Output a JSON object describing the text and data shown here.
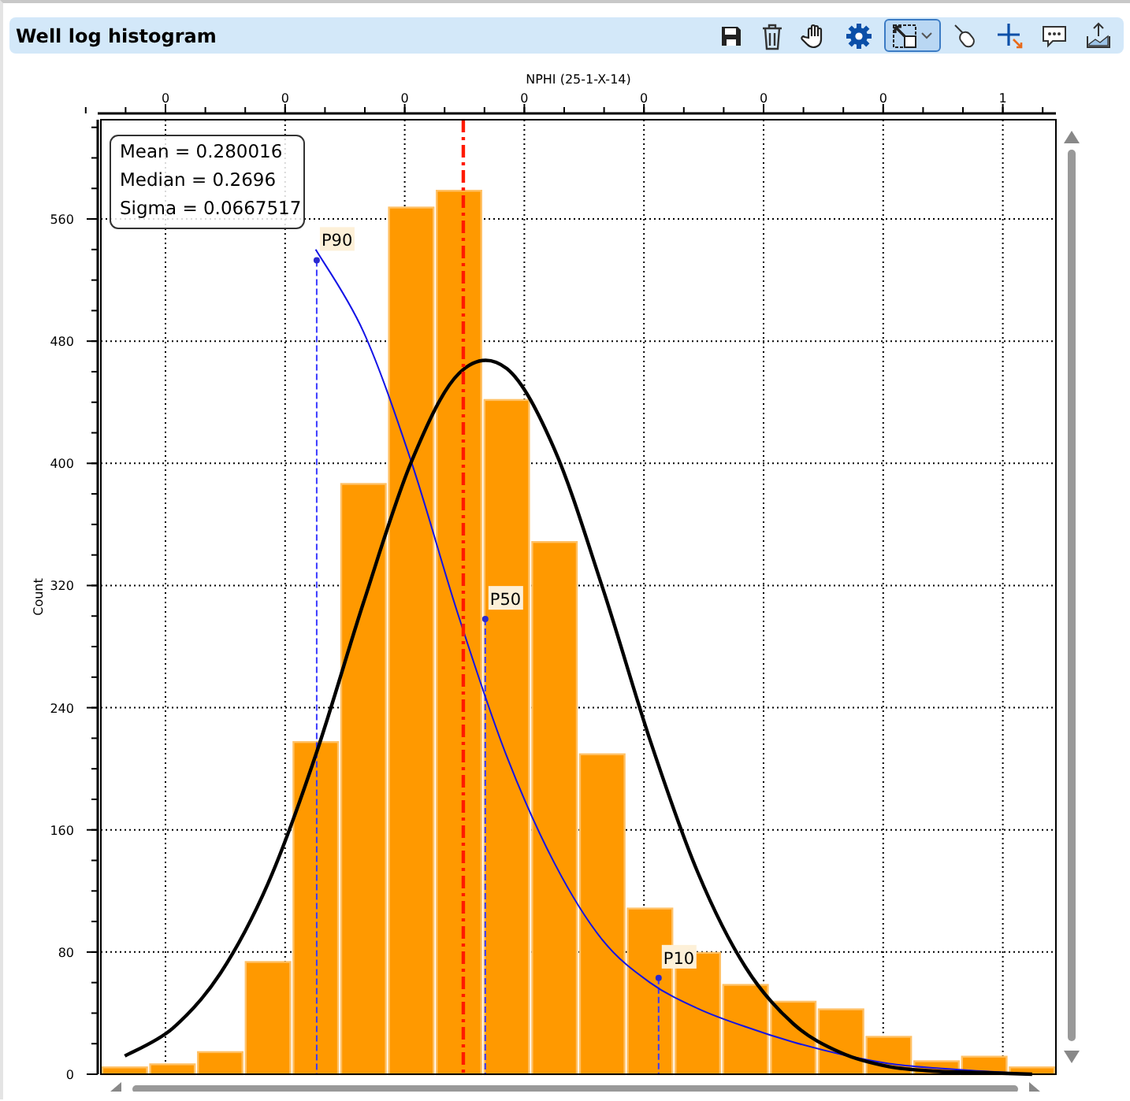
{
  "panel": {
    "title": "Well log histogram"
  },
  "toolbar": [
    {
      "kind": "save",
      "selected": false
    },
    {
      "kind": "delete",
      "selected": false
    },
    {
      "kind": "pan",
      "selected": false
    },
    {
      "kind": "settings",
      "selected": false
    },
    {
      "kind": "zoom",
      "selected": true
    },
    {
      "kind": "pointer",
      "selected": false
    },
    {
      "kind": "crosshair",
      "selected": false
    },
    {
      "kind": "comment",
      "selected": false
    },
    {
      "kind": "export",
      "selected": false
    }
  ],
  "stats": [
    "Mean = 0.280016",
    "Median = 0.2696",
    "Sigma = 0.0667517"
  ],
  "top_axis": {
    "tick_labels": [
      "0",
      "0",
      "0",
      "0",
      "0",
      "0",
      "0",
      "1"
    ]
  },
  "chart_data": {
    "type": "bar",
    "title": "NPHI (25-1-X-14)",
    "ylabel": "Count",
    "categories": [
      null,
      null,
      null,
      null,
      null,
      null,
      null,
      null,
      null,
      null,
      null,
      null,
      null,
      null,
      null,
      null,
      null,
      null,
      null,
      null
    ],
    "series": [
      {
        "type": "bar",
        "color": "#ff9900",
        "values": [
          5,
          7,
          15,
          74,
          218,
          387,
          568,
          579,
          442,
          349,
          210,
          109,
          80,
          59,
          48,
          43,
          25,
          9,
          12,
          5
        ]
      },
      {
        "type": "line",
        "color": "#1414e6",
        "values": [
          null,
          null,
          null,
          null,
          540,
          486,
          401,
          299,
          208,
          138,
          88,
          60,
          43,
          31,
          21,
          13,
          7,
          4,
          2,
          0
        ]
      },
      {
        "type": "line",
        "color": "#000000",
        "values": [
          12,
          30,
          66,
          125,
          209,
          309,
          401,
          459,
          462,
          409,
          319,
          219,
          132,
          70,
          33,
          14,
          5,
          2,
          1,
          0
        ]
      }
    ],
    "ylim": [
      0,
      625
    ],
    "yticks": [
      0,
      80,
      160,
      240,
      320,
      400,
      480,
      560
    ],
    "grid": true,
    "annotations": [
      {
        "text": "P90"
      },
      {
        "text": "P50"
      },
      {
        "text": "P10"
      }
    ]
  }
}
